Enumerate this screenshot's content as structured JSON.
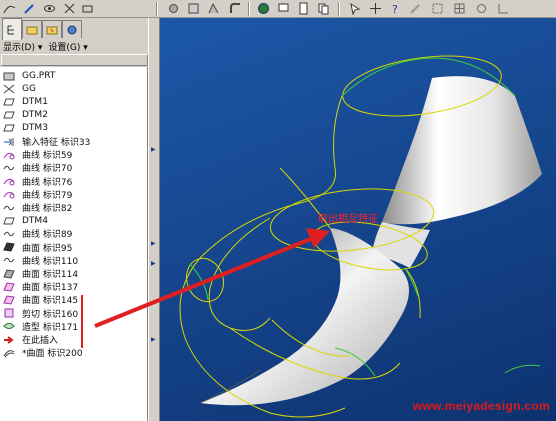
{
  "panel": {
    "menu": {
      "display_label": "显示(D) ▾",
      "settings_label": "设置(G) ▾"
    },
    "tree_items": [
      {
        "label": "GG.PRT",
        "icon": "part-icon"
      },
      {
        "label": "GG",
        "icon": "csys-icon"
      },
      {
        "label": "DTM1",
        "icon": "datum-plane-icon"
      },
      {
        "label": "DTM2",
        "icon": "datum-plane-icon"
      },
      {
        "label": "DTM3",
        "icon": "datum-plane-icon"
      },
      {
        "label": "输入特征 标识33",
        "icon": "import-feature-icon"
      },
      {
        "label": "曲线 标识59",
        "icon": "curve-sketch-icon"
      },
      {
        "label": "曲线 标识70",
        "icon": "curve-icon"
      },
      {
        "label": "曲线 标识76",
        "icon": "curve-sketch-icon"
      },
      {
        "label": "曲线 标识79",
        "icon": "curve-sketch-icon"
      },
      {
        "label": "曲线 标识82",
        "icon": "curve-icon"
      },
      {
        "label": "DTM4",
        "icon": "datum-plane-icon"
      },
      {
        "label": "曲线 标识89",
        "icon": "curve-icon"
      },
      {
        "label": "曲面 标识95",
        "icon": "surface-icon"
      },
      {
        "label": "曲线 标识110",
        "icon": "curve-icon"
      },
      {
        "label": "曲面 标识114",
        "icon": "surface-gray-icon"
      },
      {
        "label": "曲面 标识137",
        "icon": "surface-pink-icon"
      },
      {
        "label": "曲面 标识145",
        "icon": "surface-pink-icon"
      },
      {
        "label": "剪切 标识160",
        "icon": "cut-icon"
      },
      {
        "label": "造型 标识171",
        "icon": "style-icon"
      },
      {
        "label": "在此插入",
        "icon": "insert-here-icon"
      },
      {
        "label": "*曲面 标识200",
        "icon": "surface-outline-icon"
      }
    ]
  },
  "viewport": {
    "annotation": "取出相互特征",
    "watermark": "www.meiyadesign.com"
  },
  "colors": {
    "viewport_bg": "#1a4f9c",
    "wireframe": "#d8d800",
    "edge_green": "#3ccd3c",
    "arrow": "#e02020"
  }
}
